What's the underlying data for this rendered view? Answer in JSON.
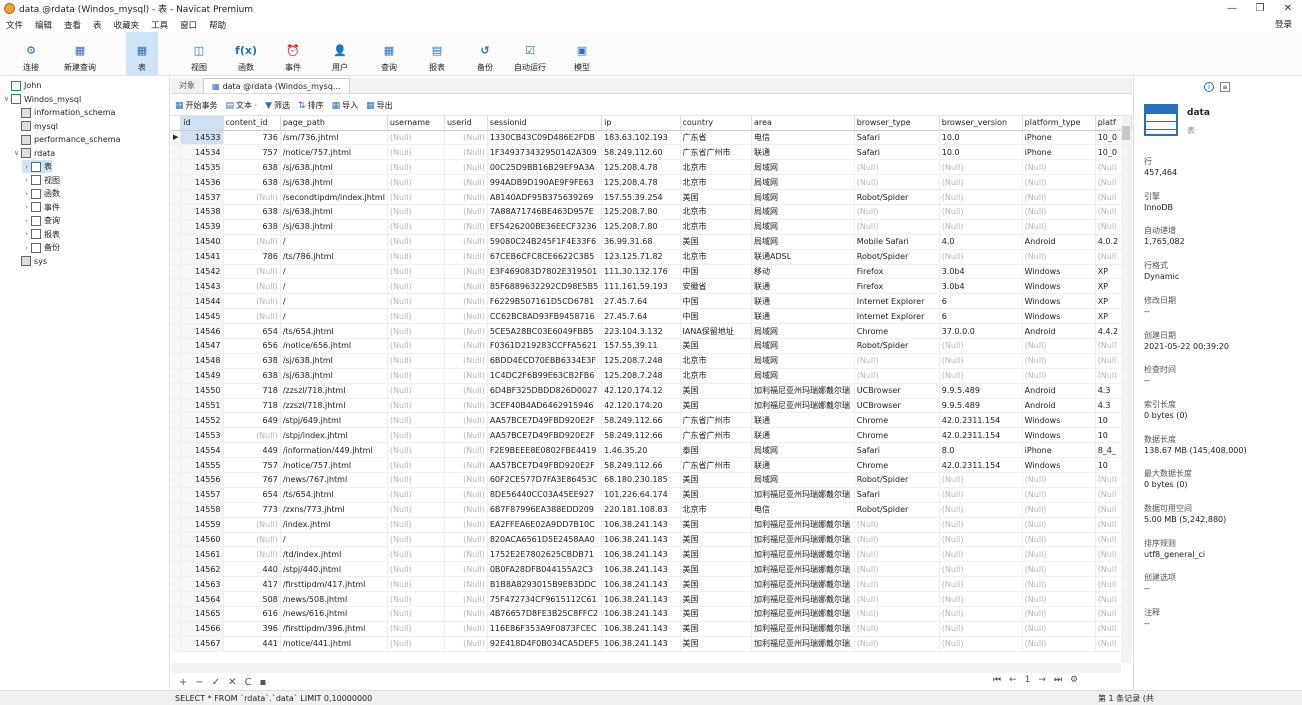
{
  "window": {
    "title": "data @rdata (Windos_mysql) - 表 - Navicat Premium",
    "controls": [
      "—",
      "❐",
      "✕"
    ]
  },
  "menu": [
    "文件",
    "编辑",
    "查看",
    "表",
    "收藏夹",
    "工具",
    "窗口",
    "帮助"
  ],
  "login": "登录",
  "toolbar": [
    {
      "label": "连接",
      "icon": "connect-icon",
      "glyph": "⚙"
    },
    {
      "label": "新建查询",
      "icon": "new-query-icon",
      "glyph": "▦"
    },
    {
      "label": "表",
      "icon": "table-icon",
      "glyph": "▦",
      "active": true
    },
    {
      "label": "视图",
      "icon": "view-icon",
      "glyph": "◫"
    },
    {
      "label": "函数",
      "icon": "function-icon",
      "glyph": "f(x)"
    },
    {
      "label": "事件",
      "icon": "event-icon",
      "glyph": "⏰"
    },
    {
      "label": "用户",
      "icon": "user-icon",
      "glyph": "👤"
    },
    {
      "label": "查询",
      "icon": "query-icon",
      "glyph": "▦"
    },
    {
      "label": "报表",
      "icon": "report-icon",
      "glyph": "▤"
    },
    {
      "label": "备份",
      "icon": "backup-icon",
      "glyph": "↺"
    },
    {
      "label": "自动运行",
      "icon": "auto-run-icon",
      "glyph": "☑"
    },
    {
      "label": "模型",
      "icon": "model-icon",
      "glyph": "▣"
    }
  ],
  "tree": [
    {
      "label": "John",
      "level": 0,
      "icon": "connection-icon",
      "arrow": ""
    },
    {
      "label": "Windos_mysql",
      "level": 0,
      "icon": "connection-icon",
      "arrow": "∨"
    },
    {
      "label": "information_schema",
      "level": 1,
      "icon": "database-icon",
      "arrow": ""
    },
    {
      "label": "mysql",
      "level": 1,
      "icon": "database-icon",
      "arrow": ""
    },
    {
      "label": "performance_schema",
      "level": 1,
      "icon": "database-icon",
      "arrow": ""
    },
    {
      "label": "rdata",
      "level": 1,
      "icon": "database-icon",
      "arrow": "∨"
    },
    {
      "label": "表",
      "level": 2,
      "icon": "table-icon",
      "arrow": "›"
    },
    {
      "label": "视图",
      "level": 2,
      "icon": "view-icon",
      "arrow": "›"
    },
    {
      "label": "函数",
      "level": 2,
      "icon": "function-icon",
      "arrow": "›"
    },
    {
      "label": "事件",
      "level": 2,
      "icon": "event-icon",
      "arrow": "›"
    },
    {
      "label": "查询",
      "level": 2,
      "icon": "query-icon",
      "arrow": "›"
    },
    {
      "label": "报表",
      "level": 2,
      "icon": "report-icon",
      "arrow": "›"
    },
    {
      "label": "备份",
      "level": 2,
      "icon": "backup-icon",
      "arrow": "›"
    },
    {
      "label": "sys",
      "level": 1,
      "icon": "database-icon",
      "arrow": ""
    }
  ],
  "tabs": [
    {
      "label": "对象"
    },
    {
      "label": "data @rdata (Windos_mysq..."
    }
  ],
  "subbar": [
    {
      "label": "开始事务",
      "glyph": "▦"
    },
    {
      "label": "文本 ·",
      "glyph": "▤"
    },
    {
      "label": "筛选",
      "glyph": "▼"
    },
    {
      "label": "排序",
      "glyph": "⇅"
    },
    {
      "label": "导入",
      "glyph": "▦"
    },
    {
      "label": "导出",
      "glyph": "▦"
    }
  ],
  "columns": [
    "id",
    "content_id",
    "page_path",
    "username",
    "userid",
    "sessionid",
    "ip",
    "country",
    "area",
    "browser_type",
    "browser_version",
    "platform_type",
    "platf"
  ],
  "rows": [
    [
      "14533",
      "736",
      "/sm/736.jhtml",
      "(Null)",
      "(Null)",
      "1330CB43C09D486E2FDB",
      "183.63.102.193",
      "广东省",
      "电信",
      "Safari",
      "10.0",
      "iPhone",
      "10_0"
    ],
    [
      "14534",
      "757",
      "/notice/757.jhtml",
      "(Null)",
      "(Null)",
      "1F349373432950142A309",
      "58.249.112.60",
      "广东省广州市",
      "联通",
      "Safari",
      "10.0",
      "iPhone",
      "10_0"
    ],
    [
      "14535",
      "638",
      "/sj/638.jhtml",
      "(Null)",
      "(Null)",
      "00C25D9BB16B29EF9A3A",
      "125.208.4.78",
      "北京市",
      "局域网",
      "(Null)",
      "(Null)",
      "(Null)",
      "(Null"
    ],
    [
      "14536",
      "638",
      "/sj/638.jhtml",
      "(Null)",
      "(Null)",
      "994ADB9D190AE9F9FE63",
      "125.208.4.78",
      "北京市",
      "局域网",
      "(Null)",
      "(Null)",
      "(Null)",
      "(Null"
    ],
    [
      "14537",
      "(Null)",
      "/secondtipdm/index.jhtml",
      "(Null)",
      "(Null)",
      "A8140ADF95B375639269",
      "157.55.39.254",
      "美国",
      "局域网",
      "Robot/Spider",
      "(Null)",
      "(Null)",
      "(Null"
    ],
    [
      "14538",
      "638",
      "/sj/638.jhtml",
      "(Null)",
      "(Null)",
      "7A88A71746BE463D957E",
      "125.208.7.80",
      "北京市",
      "局域网",
      "(Null)",
      "(Null)",
      "(Null)",
      "(Null"
    ],
    [
      "14539",
      "638",
      "/sj/638.jhtml",
      "(Null)",
      "(Null)",
      "EF5426200BE36EECF3236",
      "125.208.7.80",
      "北京市",
      "局域网",
      "(Null)",
      "(Null)",
      "(Null)",
      "(Null"
    ],
    [
      "14540",
      "(Null)",
      "/",
      "(Null)",
      "(Null)",
      "59080C24B245F1F4E33F6",
      "36.99.31.68",
      "美国",
      "局域网",
      "Mobile Safari",
      "4.0",
      "Android",
      "4.0.2"
    ],
    [
      "14541",
      "786",
      "/ts/786.jhtml",
      "(Null)",
      "(Null)",
      "67CEB6CFC8CE6622C3B5",
      "123.125.71.82",
      "北京市",
      "联通ADSL",
      "Robot/Spider",
      "(Null)",
      "(Null)",
      "(Null"
    ],
    [
      "14542",
      "(Null)",
      "/",
      "(Null)",
      "(Null)",
      "E3F469083D7802E319501",
      "111.30.132.176",
      "中国",
      "移动",
      "Firefox",
      "3.0b4",
      "Windows",
      "XP"
    ],
    [
      "14543",
      "(Null)",
      "/",
      "(Null)",
      "(Null)",
      "85F6889632292CD98E5B5",
      "111.161.59.193",
      "安徽省",
      "联通",
      "Firefox",
      "3.0b4",
      "Windows",
      "XP"
    ],
    [
      "14544",
      "(Null)",
      "/",
      "(Null)",
      "(Null)",
      "F6229B507161D5CD6781",
      "27.45.7.64",
      "中国",
      "联通",
      "Internet Explorer",
      "6",
      "Windows",
      "XP"
    ],
    [
      "14545",
      "(Null)",
      "/",
      "(Null)",
      "(Null)",
      "CC62BC8AD93FB9458716",
      "27.45.7.64",
      "中国",
      "联通",
      "Internet Explorer",
      "6",
      "Windows",
      "XP"
    ],
    [
      "14546",
      "654",
      "/ts/654.jhtml",
      "(Null)",
      "(Null)",
      "5CE5A28BC03E6049FBB5",
      "223.104.3.132",
      "IANA保留地址",
      "局域网",
      "Chrome",
      "37.0.0.0",
      "Android",
      "4.4.2"
    ],
    [
      "14547",
      "656",
      "/notice/656.jhtml",
      "(Null)",
      "(Null)",
      "F0361D219283CCFFA5621",
      "157.55.39.11",
      "美国",
      "局域网",
      "Robot/Spider",
      "(Null)",
      "(Null)",
      "(Null"
    ],
    [
      "14548",
      "638",
      "/sj/638.jhtml",
      "(Null)",
      "(Null)",
      "6BDD4ECD70EBB6334E3F",
      "125.208.7.248",
      "北京市",
      "局域网",
      "(Null)",
      "(Null)",
      "(Null)",
      "(Null"
    ],
    [
      "14549",
      "638",
      "/sj/638.jhtml",
      "(Null)",
      "(Null)",
      "1C4DC2F6B99E63CB2FB6",
      "125.208.7.248",
      "北京市",
      "局域网",
      "(Null)",
      "(Null)",
      "(Null)",
      "(Null"
    ],
    [
      "14550",
      "718",
      "/zzszl/718.jhtml",
      "(Null)",
      "(Null)",
      "6D4BF325DBDD826D0027",
      "42.120.174.12",
      "美国",
      "加利福尼亚州玛瑞娜戴尔瑞",
      "UCBrowser",
      "9.9.5.489",
      "Android",
      "4.3"
    ],
    [
      "14551",
      "718",
      "/zzszl/718.jhtml",
      "(Null)",
      "(Null)",
      "3CEF40B4AD6462915946",
      "42.120.174.20",
      "美国",
      "加利福尼亚州玛瑞娜戴尔瑞",
      "UCBrowser",
      "9.9.5.489",
      "Android",
      "4.3"
    ],
    [
      "14552",
      "649",
      "/stpj/649.jhtml",
      "(Null)",
      "(Null)",
      "AA57BCE7D49FBD920E2F",
      "58.249.112.66",
      "广东省广州市",
      "联通",
      "Chrome",
      "42.0.2311.154",
      "Windows",
      "10"
    ],
    [
      "14553",
      "(Null)",
      "/stpj/index.jhtml",
      "(Null)",
      "(Null)",
      "AA57BCE7D49FBD920E2F",
      "58.249.112.66",
      "广东省广州市",
      "联通",
      "Chrome",
      "42.0.2311.154",
      "Windows",
      "10"
    ],
    [
      "14554",
      "449",
      "/information/449.jhtml",
      "(Null)",
      "(Null)",
      "F2E9BEEE8E0802FBE4419",
      "1.46.35.20",
      "泰国",
      "局域网",
      "Safari",
      "8.0",
      "iPhone",
      "8_4_"
    ],
    [
      "14555",
      "757",
      "/notice/757.jhtml",
      "(Null)",
      "(Null)",
      "AA57BCE7D49FBD920E2F",
      "58.249.112.66",
      "广东省广州市",
      "联通",
      "Chrome",
      "42.0.2311.154",
      "Windows",
      "10"
    ],
    [
      "14556",
      "767",
      "/news/767.jhtml",
      "(Null)",
      "(Null)",
      "60F2CE577D7FA3E86453C",
      "68.180.230.185",
      "美国",
      "局域网",
      "Robot/Spider",
      "(Null)",
      "(Null)",
      "(Null"
    ],
    [
      "14557",
      "654",
      "/ts/654.jhtml",
      "(Null)",
      "(Null)",
      "8DE56440CC03A45EE927",
      "101.226.64.174",
      "美国",
      "加利福尼亚州玛瑞娜戴尔瑞",
      "Safari",
      "(Null)",
      "(Null)",
      "(Null"
    ],
    [
      "14558",
      "773",
      "/zxns/773.jhtml",
      "(Null)",
      "(Null)",
      "6B7F87996EA388EDD209",
      "220.181.108.83",
      "北京市",
      "电信",
      "Robot/Spider",
      "(Null)",
      "(Null)",
      "(Null"
    ],
    [
      "14559",
      "(Null)",
      "/index.jhtml",
      "(Null)",
      "(Null)",
      "EA2FFEA6E02A9DD7B10C",
      "106.38.241.143",
      "美国",
      "加利福尼亚州玛瑞娜戴尔瑞",
      "(Null)",
      "(Null)",
      "(Null)",
      "(Null"
    ],
    [
      "14560",
      "(Null)",
      "/",
      "(Null)",
      "(Null)",
      "820ACA6561D5E2458AA0",
      "106.38.241.143",
      "美国",
      "加利福尼亚州玛瑞娜戴尔瑞",
      "(Null)",
      "(Null)",
      "(Null)",
      "(Null"
    ],
    [
      "14561",
      "(Null)",
      "/td/index.jhtml",
      "(Null)",
      "(Null)",
      "1752E2E7802625CBDB71",
      "106.38.241.143",
      "美国",
      "加利福尼亚州玛瑞娜戴尔瑞",
      "(Null)",
      "(Null)",
      "(Null)",
      "(Null"
    ],
    [
      "14562",
      "440",
      "/stpj/440.jhtml",
      "(Null)",
      "(Null)",
      "0B0FA28DFB044155A2C3",
      "106.38.241.143",
      "美国",
      "加利福尼亚州玛瑞娜戴尔瑞",
      "(Null)",
      "(Null)",
      "(Null)",
      "(Null"
    ],
    [
      "14563",
      "417",
      "/firsttipdm/417.jhtml",
      "(Null)",
      "(Null)",
      "B1B8A8293015B9EB3DDC",
      "106.38.241.143",
      "美国",
      "加利福尼亚州玛瑞娜戴尔瑞",
      "(Null)",
      "(Null)",
      "(Null)",
      "(Null"
    ],
    [
      "14564",
      "508",
      "/news/508.jhtml",
      "(Null)",
      "(Null)",
      "75F472734CF9615112C61",
      "106.38.241.143",
      "美国",
      "加利福尼亚州玛瑞娜戴尔瑞",
      "(Null)",
      "(Null)",
      "(Null)",
      "(Null"
    ],
    [
      "14565",
      "616",
      "/news/616.jhtml",
      "(Null)",
      "(Null)",
      "4B76657D8FE3B25C8FFC2",
      "106.38.241.143",
      "美国",
      "加利福尼亚州玛瑞娜戴尔瑞",
      "(Null)",
      "(Null)",
      "(Null)",
      "(Null"
    ],
    [
      "14566",
      "396",
      "/firsttipdm/396.jhtml",
      "(Null)",
      "(Null)",
      "116E86F353A9F0873FCEC",
      "106.38.241.143",
      "美国",
      "加利福尼亚州玛瑞娜戴尔瑞",
      "(Null)",
      "(Null)",
      "(Null)",
      "(Null"
    ],
    [
      "14567",
      "441",
      "/notice/441.jhtml",
      "(Null)",
      "(Null)",
      "92E418D4F0B034CA5DEF5",
      "106.38.241.143",
      "美国",
      "加利福尼亚州玛瑞娜戴尔瑞",
      "(Null)",
      "(Null)",
      "(Null)",
      "(Null"
    ]
  ],
  "info": {
    "name": "data",
    "type": "表",
    "fields": [
      {
        "label": "行",
        "value": "457,464"
      },
      {
        "label": "引擎",
        "value": "InnoDB"
      },
      {
        "label": "自动递增",
        "value": "1,765,082"
      },
      {
        "label": "行格式",
        "value": "Dynamic"
      },
      {
        "label": "修改日期",
        "value": "--"
      },
      {
        "label": "创建日期",
        "value": "2021-05-22 00:39:20"
      },
      {
        "label": "检查时间",
        "value": "--"
      },
      {
        "label": "索引长度",
        "value": "0 bytes (0)"
      },
      {
        "label": "数据长度",
        "value": "138.67 MB (145,408,000)"
      },
      {
        "label": "最大数据长度",
        "value": "0 bytes (0)"
      },
      {
        "label": "数据可用空间",
        "value": "5.00 MB (5,242,880)"
      },
      {
        "label": "排序规则",
        "value": "utf8_general_ci"
      },
      {
        "label": "创建选项",
        "value": "--"
      },
      {
        "label": "注释",
        "value": "--"
      }
    ]
  },
  "bottom": {
    "controls": [
      "+",
      "−",
      "✓",
      "✕",
      "C",
      "▪"
    ],
    "nav": [
      "⏮",
      "←",
      "1",
      "→",
      "⏭",
      "⚙"
    ]
  },
  "status": {
    "sql": "SELECT * FROM `rdata`.`data` LIMIT 0,10000000",
    "records": "第 1 条记录 (共"
  },
  "colors": {
    "accent": "#2a6fba",
    "selected_tab": "#cfe4f7",
    "null_text": "#b5b5b5"
  }
}
